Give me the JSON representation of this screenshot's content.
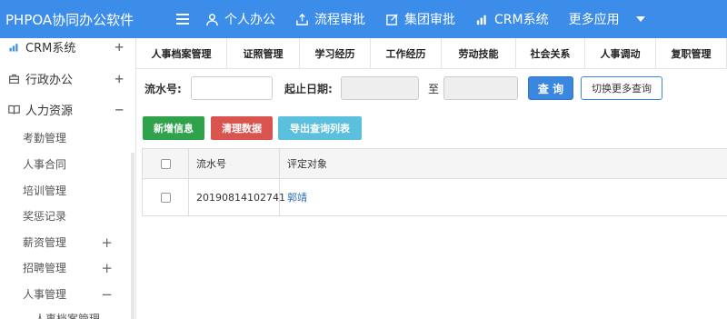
{
  "app": {
    "title": "PHPOA协同办公软件"
  },
  "topnav": [
    {
      "label": "个人办公",
      "icon": "user-icon"
    },
    {
      "label": "流程审批",
      "icon": "share-icon"
    },
    {
      "label": "集团审批",
      "icon": "edit-icon"
    },
    {
      "label": "CRM系统",
      "icon": "bar-chart-icon"
    },
    {
      "label": "更多应用",
      "icon": "caret-down-icon"
    }
  ],
  "sidebar": {
    "items": [
      {
        "label": "CRM系统",
        "toggle": "+"
      },
      {
        "label": "行政办公",
        "toggle": "+"
      },
      {
        "label": "人力资源",
        "toggle": "−"
      }
    ],
    "subitems": [
      {
        "label": "考勤管理"
      },
      {
        "label": "人事合同"
      },
      {
        "label": "培训管理"
      },
      {
        "label": "奖惩记录"
      },
      {
        "label": "薪资管理",
        "toggle": "+"
      },
      {
        "label": "招聘管理",
        "toggle": "+"
      },
      {
        "label": "人事管理",
        "toggle": "−"
      },
      {
        "label": "人事档案管理"
      }
    ]
  },
  "tabs": [
    "人事档案管理",
    "证照管理",
    "学习经历",
    "工作经历",
    "劳动技能",
    "社会关系",
    "人事调动",
    "复职管理"
  ],
  "search": {
    "serial_label": "流水号:",
    "date_label": "起止日期:",
    "to_label": "至",
    "query_button": "查 询",
    "more_button": "切换更多查询"
  },
  "actions": {
    "add": "新增信息",
    "clear": "清理数据",
    "export": "导出查询列表"
  },
  "table": {
    "headers": [
      "流水号",
      "评定对象"
    ],
    "rows": [
      {
        "serial": "20190814102741",
        "person": "郭靖"
      }
    ]
  },
  "colors": {
    "topbar": "#3c8dea",
    "primary": "#3a87e0",
    "green": "#2fa34b",
    "red": "#d9534f",
    "cyan": "#5bc0de"
  }
}
